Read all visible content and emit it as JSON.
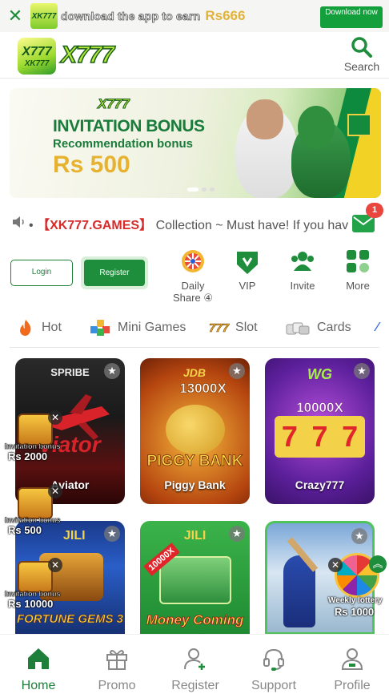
{
  "download_bar": {
    "logo_text": "XK777",
    "text": "download the app to earn",
    "amount": "Rs666",
    "button_label": "Download now"
  },
  "header": {
    "badge_line1": "X777",
    "badge_line2": "XK777",
    "logo_word": "X777",
    "search_label": "Search"
  },
  "banner": {
    "brand": "X777",
    "title": "INVITATION BONUS",
    "subtitle": "Recommendation bonus",
    "amount": "Rs 500",
    "active_slide": 1,
    "slide_count": 3
  },
  "marquee": {
    "prefix": "•",
    "highlight": "【XK777.GAMES】",
    "text": "Collection ~ Must have! If you hav",
    "mail_badge": "1"
  },
  "auth": {
    "login_label": "Login",
    "register_label": "Register"
  },
  "quick_actions": [
    {
      "label": "Daily Share ④",
      "icon": "wheel-icon"
    },
    {
      "label": "VIP",
      "icon": "vip-shield-icon"
    },
    {
      "label": "Invite",
      "icon": "users-icon"
    },
    {
      "label": "More",
      "icon": "grid-icon"
    }
  ],
  "tabs": [
    {
      "label": "Hot",
      "icon": "flame-icon"
    },
    {
      "label": "Mini Games",
      "icon": "cubes-icon"
    },
    {
      "label": "Slot",
      "icon": "slot-777-icon"
    },
    {
      "label": "Cards",
      "icon": "cards-icon"
    }
  ],
  "games": [
    {
      "name": "Aviator",
      "brand": "SPRIBE",
      "big": ""
    },
    {
      "name": "Piggy Bank",
      "brand": "JDB",
      "big": "13000X"
    },
    {
      "name": "Crazy777",
      "brand": "WG",
      "big": "10000X"
    },
    {
      "name": "",
      "brand": "JILI",
      "big": "FORTUNE GEMS 3"
    },
    {
      "name": "",
      "brand": "JILI",
      "big": "Money Coming"
    },
    {
      "name": "",
      "brand": "",
      "big": ""
    }
  ],
  "invitations": [
    {
      "label": "Invitation bonus",
      "amount": "Rs 2000"
    },
    {
      "label": "Invitation bonus",
      "amount": "Rs 500"
    },
    {
      "label": "Invitation bonus",
      "amount": "Rs 10000"
    }
  ],
  "weekly": {
    "label": "Weekly lottery",
    "amount": "Rs 1000"
  },
  "bottom_nav": [
    {
      "label": "Home",
      "active": true
    },
    {
      "label": "Promo"
    },
    {
      "label": "Register"
    },
    {
      "label": "Support"
    },
    {
      "label": "Profile"
    }
  ],
  "colors": {
    "brand_green": "#1e8d3c",
    "gold": "#e6b230",
    "alert_red": "#d72a2a"
  }
}
